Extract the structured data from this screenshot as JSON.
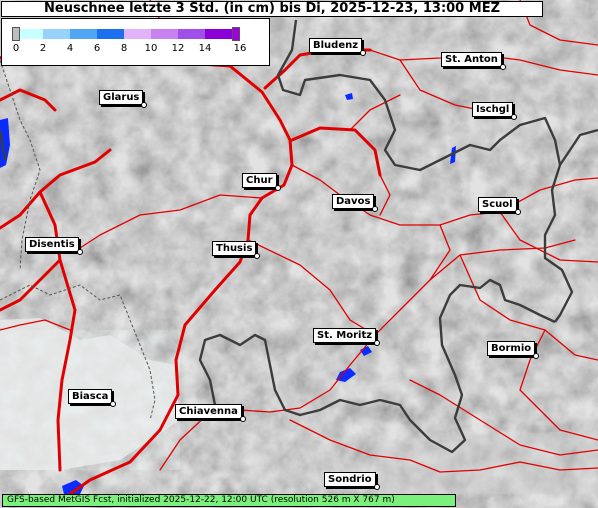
{
  "title": "Neuschnee letzte 3 Std. (in cm) bis Di, 2025-12-23, 13:00 MEZ",
  "legend": {
    "ticks": [
      "0",
      "2",
      "4",
      "6",
      "8",
      "10",
      "12",
      "14",
      "16"
    ],
    "colors": [
      "#c8ffff",
      "#96d2fa",
      "#50a5f5",
      "#1e6ef0",
      "#e1b4fa",
      "#c882f0",
      "#a050e8",
      "#8c00d8"
    ],
    "below_color": "#bdbdbd",
    "above_color": "#a000e0"
  },
  "places": [
    {
      "name": "Bludenz"
    },
    {
      "name": "St. Anton"
    },
    {
      "name": "Glarus"
    },
    {
      "name": "Ischgl"
    },
    {
      "name": "Chur"
    },
    {
      "name": "Davos"
    },
    {
      "name": "Scuol"
    },
    {
      "name": "Disentis"
    },
    {
      "name": "Thusis"
    },
    {
      "name": "St. Moritz"
    },
    {
      "name": "Bormio"
    },
    {
      "name": "Biasca"
    },
    {
      "name": "Chiavenna"
    },
    {
      "name": "Sondrio"
    }
  ],
  "footer": "GFS-based MetGIS Fcst, initialized 2025-12-22, 12:00 UTC  (resolution 526 m X 767 m)",
  "colors": {
    "roads": "#e00000",
    "borders": "#404040",
    "water": "#0a2cff",
    "footer_bg": "#7cf07c"
  }
}
